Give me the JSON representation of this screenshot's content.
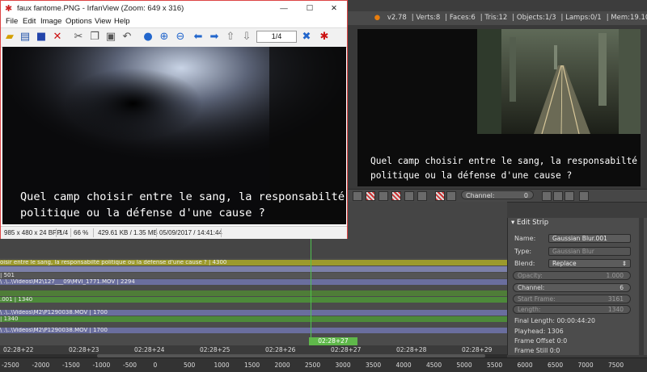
{
  "irfanview": {
    "title": "faux fantome.PNG - IrfanView (Zoom: 649 x 316)",
    "menu": [
      "File",
      "Edit",
      "Image",
      "Options",
      "View",
      "Help"
    ],
    "page_field": "1/4",
    "subtitle_line1": "Quel camp choisir entre le sang, la responsabilté",
    "subtitle_line2": "politique ou la défense d'une cause ?",
    "status": {
      "dimensions": "985 x 480 x 24 BPP",
      "page": "1/4",
      "zoom": "66 %",
      "size": "429.61 KB / 1.35 MB",
      "date": "05/09/2017 / 14:41:44"
    },
    "window_controls": {
      "minimize": "—",
      "maximize": "☐",
      "close": "✕"
    }
  },
  "blender": {
    "header": {
      "version": "v2.78",
      "verts": "Verts:8",
      "faces": "Faces:6",
      "tris": "Tris:12",
      "objects": "Objects:1/3",
      "lamps": "Lamps:0/1",
      "mem": "Mem:19.10M (253.73M)"
    },
    "preview": {
      "subtitle_line1": "Quel camp choisir entre le sang, la responsabilté",
      "subtitle_line2": "politique ou la défense d'une cause ?"
    },
    "preview_toolbar": {
      "channel_label": "Channel:",
      "channel_value": "0"
    },
    "sequencer": {
      "strips": [
        {
          "label": "oisir entre le sang, la responsabilté politique ou la défense d'une cause ? | 4300",
          "color": "#9c9a2c"
        },
        {
          "label": "",
          "color": "#7c80a8"
        },
        {
          "label": "| 501",
          "color": "#555555"
        },
        {
          "label": "\\ .\\..\\Videos\\M2\\127___09\\MVI_1771.MOV | 2294",
          "color": "#6a6e9e"
        },
        {
          "label": "",
          "color": "#4f7d38"
        },
        {
          "label": ".001 | 1340",
          "color": "#4d8a3a"
        },
        {
          "label": "\\ .\\..\\Videos\\M2\\P1290038.MOV | 1700",
          "color": "#6a6e9e"
        },
        {
          "label": "| 1340",
          "color": "#4d8a3a"
        },
        {
          "label": "\\ .\\..\\Videos\\M2\\P1290038.MOV | 1700",
          "color": "#6a6e9e"
        }
      ],
      "timeline_ticks": [
        "02:28+22",
        "02:28+23",
        "02:28+24",
        "02:28+25",
        "02:28+26",
        "02:28+27",
        "02:28+28",
        "02:28+29",
        "02:29+00"
      ],
      "playhead_label": "02:28+27",
      "frame_ticks": [
        "-2500",
        "-2000",
        "-1500",
        "-1000",
        "-500",
        "0",
        "500",
        "1000",
        "1500",
        "2000",
        "2500",
        "3000",
        "3500",
        "4000",
        "4500",
        "5000",
        "5500",
        "6000",
        "6500",
        "7000",
        "7500"
      ]
    },
    "edit_strip": {
      "panel_title": "Edit Strip",
      "name_label": "Name:",
      "name_value": "Gaussian Blur.001",
      "type_label": "Type:",
      "type_value": "Gaussian Blur",
      "blend_label": "Blend:",
      "blend_value": "Replace",
      "opacity_label": "Opacity:",
      "opacity_value": "1.000",
      "channel_label": "Channel:",
      "channel_value": "6",
      "start_label": "Start Frame:",
      "start_value": "3161",
      "length_label": "Length:",
      "length_value": "1340",
      "final_length": "Final Length: 00:00:44:20",
      "playhead": "Playhead: 1306",
      "frame_offset": "Frame Offset 0:0",
      "frame_still": "Frame Still 0:0"
    }
  }
}
